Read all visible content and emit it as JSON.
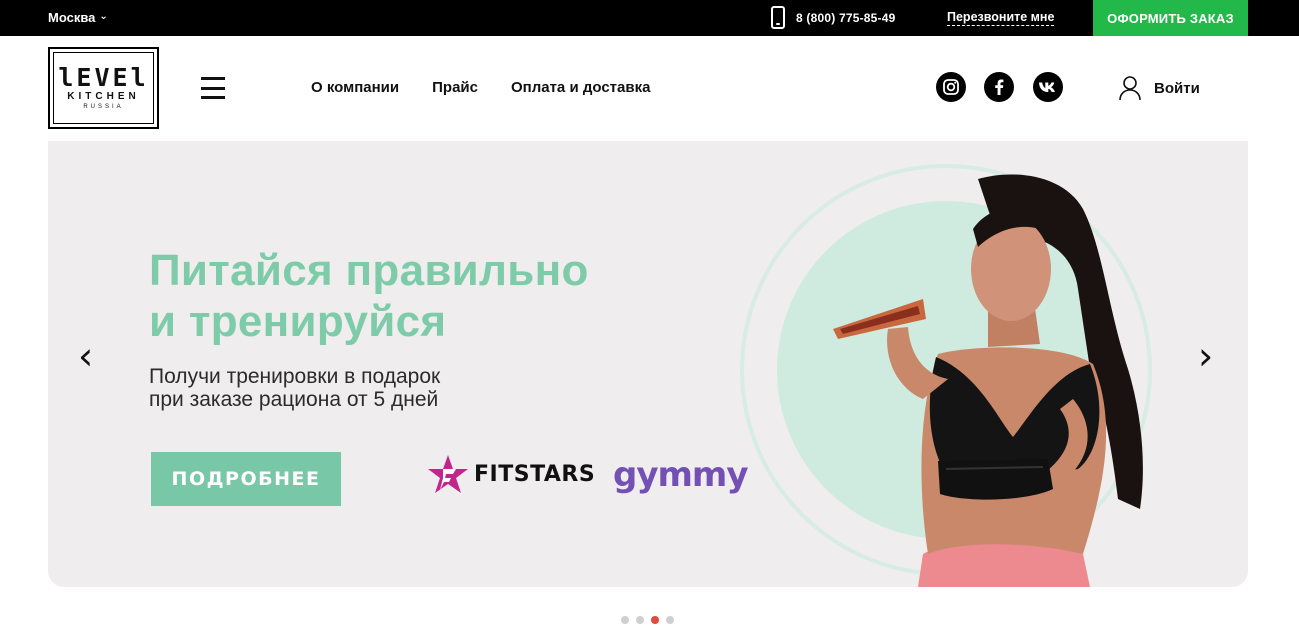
{
  "topbar": {
    "city": "Москва",
    "phone": "8 (800) 775-85-49",
    "callback_label": "Перезвоните мне",
    "order_label": "ОФОРМИТЬ ЗАКАЗ"
  },
  "logo": {
    "main": "lEVEl",
    "sub": "KITCHEN",
    "tiny": "RUSSIA"
  },
  "nav": {
    "items": [
      "О компании",
      "Прайс",
      "Оплата и доставка"
    ]
  },
  "social": {
    "icons": [
      "instagram-icon",
      "facebook-icon",
      "vk-icon"
    ]
  },
  "login_label": "Войти",
  "banner": {
    "headline_line1": "Питайся правильно",
    "headline_line2": "и тренируйся",
    "sub_line1": "Получи тренировки в подарок",
    "sub_line2": "при заказе рациона от 5 дней",
    "button_label": "ПОДРОБНЕЕ",
    "partner1": "FITSTARS",
    "partner2": "gymmy",
    "prev_arrow": "‹",
    "next_arrow": "›"
  },
  "slider": {
    "count": 4,
    "active_index": 2
  },
  "colors": {
    "accent_green": "#22b84a",
    "headline_mint": "#7ecba9",
    "button_mint": "#78c7a6",
    "gymmy_purple": "#7450b4",
    "fitstars_pink": "#c2268a",
    "active_dot": "#e2493a"
  }
}
